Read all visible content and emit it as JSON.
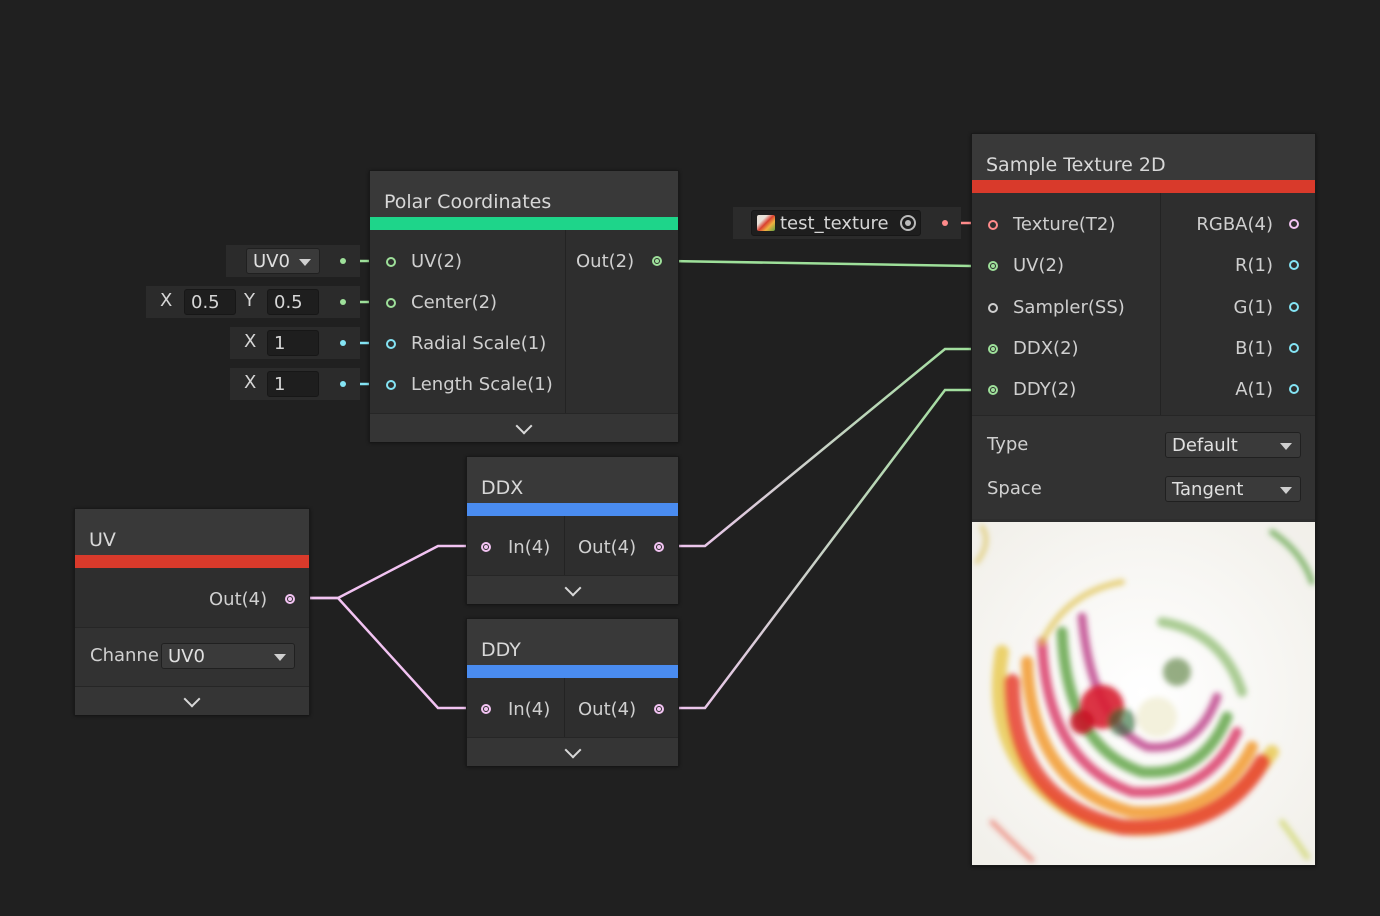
{
  "nodes": {
    "polar": {
      "title": "Polar Coordinates",
      "color": "#1ed58a",
      "inputs": [
        "UV(2)",
        "Center(2)",
        "Radial Scale(1)",
        "Length Scale(1)"
      ],
      "output": "Out(2)"
    },
    "sample": {
      "title": "Sample Texture 2D",
      "color": "#d93a2b",
      "inputs": [
        "Texture(T2)",
        "UV(2)",
        "Sampler(SS)",
        "DDX(2)",
        "DDY(2)"
      ],
      "outputs": [
        "RGBA(4)",
        "R(1)",
        "G(1)",
        "B(1)",
        "A(1)"
      ],
      "type_label": "Type",
      "type_value": "Default",
      "space_label": "Space",
      "space_value": "Tangent"
    },
    "ddx": {
      "title": "DDX",
      "color": "#4a8cf0",
      "input": "In(4)",
      "output": "Out(4)"
    },
    "ddy": {
      "title": "DDY",
      "color": "#4a8cf0",
      "input": "In(4)",
      "output": "Out(4)"
    },
    "uv": {
      "title": "UV",
      "color": "#d93a2b",
      "output": "Out(4)",
      "channel_label": "Channe",
      "channel_value": "UV0"
    }
  },
  "inline": {
    "uv_dropdown": "UV0",
    "center_x_label": "X",
    "center_x": "0.5",
    "center_y_label": "Y",
    "center_y": "0.5",
    "radial_x_label": "X",
    "radial_x": "1",
    "length_x_label": "X",
    "length_x": "1",
    "texture_name": "test_texture"
  },
  "colors": {
    "vec2": "#9ee09a",
    "vec1": "#84e4f4",
    "vec4": "#f2c3f2",
    "texture": "#ff8b8b",
    "sampler": "#cfcfcf",
    "background": "#202020"
  }
}
